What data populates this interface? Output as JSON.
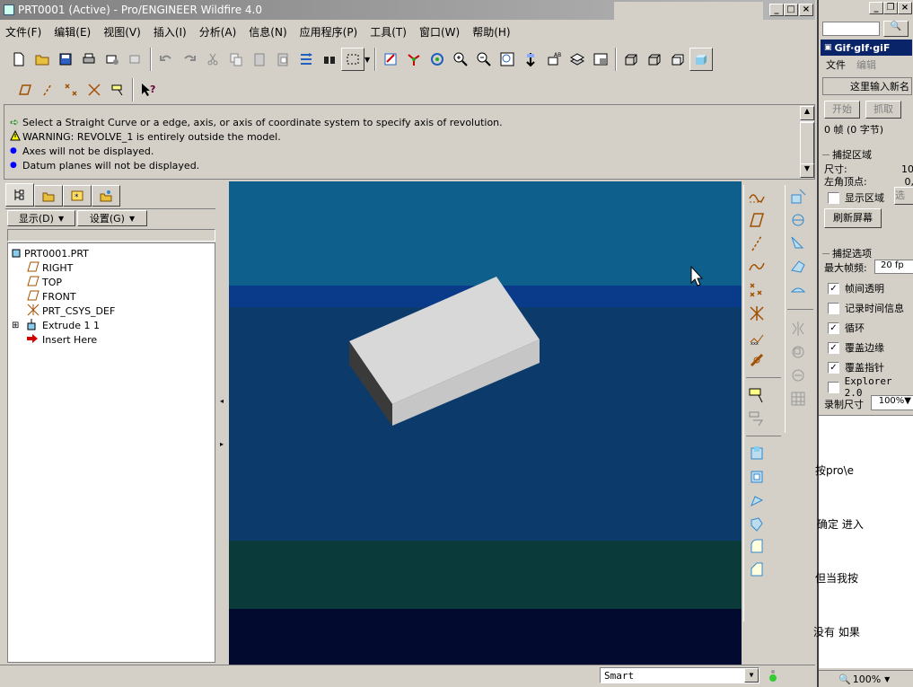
{
  "window": {
    "title": "PRT0001 (Active) - Pro/ENGINEER Wildfire 4.0"
  },
  "menu": [
    "文件(F)",
    "编辑(E)",
    "视图(V)",
    "插入(I)",
    "分析(A)",
    "信息(N)",
    "应用程序(P)",
    "工具(T)",
    "窗口(W)",
    "帮助(H)"
  ],
  "messages": [
    {
      "icon": "arrow-icon",
      "text": "Select a  Straight Curve or a edge, axis, or axis of coordinate system to specify axis of revolution."
    },
    {
      "icon": "warning-icon",
      "text": "WARNING: REVOLVE_1 is entirely outside the model."
    },
    {
      "icon": "bullet-icon",
      "text": "Axes will not be displayed."
    },
    {
      "icon": "bullet-icon",
      "text": "Datum planes will not be displayed."
    }
  ],
  "tree": {
    "show_label": "显示(D)",
    "settings_label": "设置(G)",
    "items": [
      "PRT0001.PRT",
      "RIGHT",
      "TOP",
      "FRONT",
      "PRT_CSYS_DEF",
      "Extrude 1 1",
      "Insert Here"
    ]
  },
  "status": {
    "filter": "Smart"
  },
  "side": {
    "title": "Gif·gIf·giF",
    "menu_file": "文件",
    "menu_edit": "编辑",
    "input_label": "这里输入新名",
    "start": "开始",
    "capture": "抓取",
    "frames": "0 帧 (0 字节)",
    "capture_region": "捕捉区域",
    "size_label": "尺寸:",
    "size_val": "10",
    "corner_label": "左角顶点:",
    "corner_val": "0,",
    "show_region": "显示区域",
    "select_btn": "选",
    "refresh": "刷新屏幕",
    "capture_opts": "捕捉选项",
    "max_fps_label": "最大帧频:",
    "max_fps_val": "20 fp",
    "opts": [
      {
        "label": "帧间透明",
        "checked": true
      },
      {
        "label": "记录时间信息",
        "checked": false
      },
      {
        "label": "循环",
        "checked": true
      },
      {
        "label": "覆盖边缘",
        "checked": true
      },
      {
        "label": "覆盖指针",
        "checked": true
      },
      {
        "label": "Explorer 2.0",
        "checked": false
      }
    ],
    "rec_size_label": "录制尺寸",
    "rec_size_val": "100%",
    "doc_lines": [
      "按pro\\e",
      "确定 进入",
      "但当我按",
      "没有 如果"
    ],
    "zoom": "100%"
  },
  "colors": {
    "viewport_top": "#0f5f8c",
    "viewport_band": "#0a3a8a",
    "viewport_mid": "#0b3a6b",
    "viewport_low": "#0b3a3a",
    "viewport_bottom": "#020a30",
    "box_top": "#d8d8d8",
    "box_front": "#c6c6c6",
    "box_side": "#3a3a3a"
  }
}
